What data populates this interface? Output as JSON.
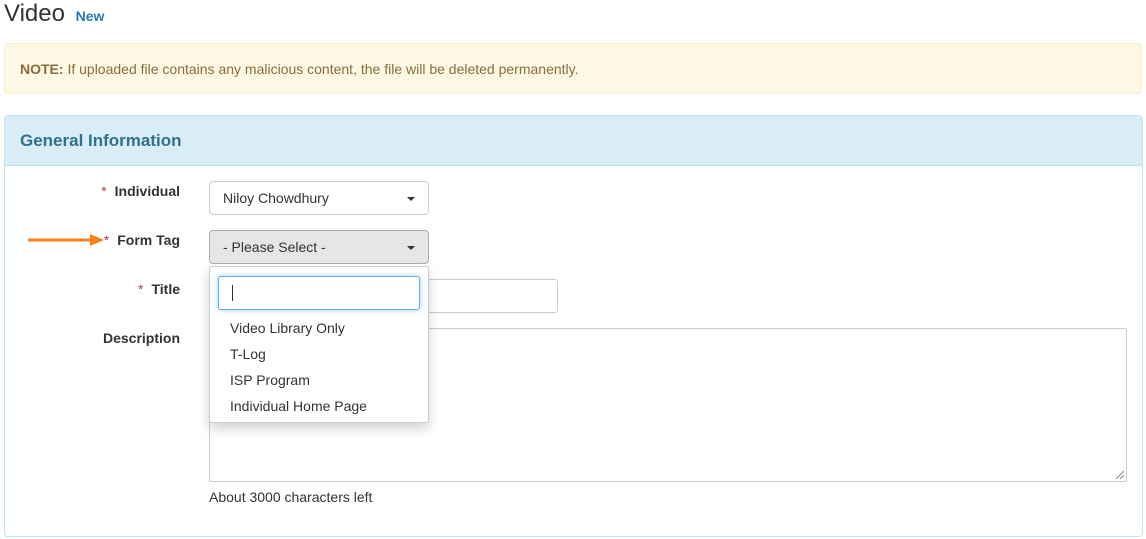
{
  "page": {
    "title": "Video",
    "badge": "New"
  },
  "alert": {
    "label": "NOTE:",
    "message": " If uploaded file contains any malicious content, the file will be deleted permanently."
  },
  "panel": {
    "heading": "General Information"
  },
  "form": {
    "individual": {
      "required": "*",
      "label": "Individual",
      "value": "Niloy Chowdhury"
    },
    "form_tag": {
      "required": "*",
      "label": "Form Tag",
      "value": "- Please Select -"
    },
    "title": {
      "required": "*",
      "label": "Title",
      "value": ""
    },
    "description": {
      "label": "Description",
      "value": "",
      "help": "About 3000 characters left"
    }
  },
  "dropdown": {
    "search_value": "",
    "options": [
      "Video Library Only",
      "T-Log",
      "ISP Program",
      "Individual Home Page"
    ]
  },
  "colors": {
    "accent": "#2a7ab5",
    "panel_heading_bg": "#d9edf7",
    "panel_heading_text": "#31708f",
    "alert_bg": "#fcf8e3",
    "alert_text": "#8a6d3b",
    "required": "#a94442",
    "arrow": "#f5821f"
  },
  "icons": {
    "select_caret": "caret-down-icon",
    "annotation_arrow": "arrow-right-icon"
  }
}
